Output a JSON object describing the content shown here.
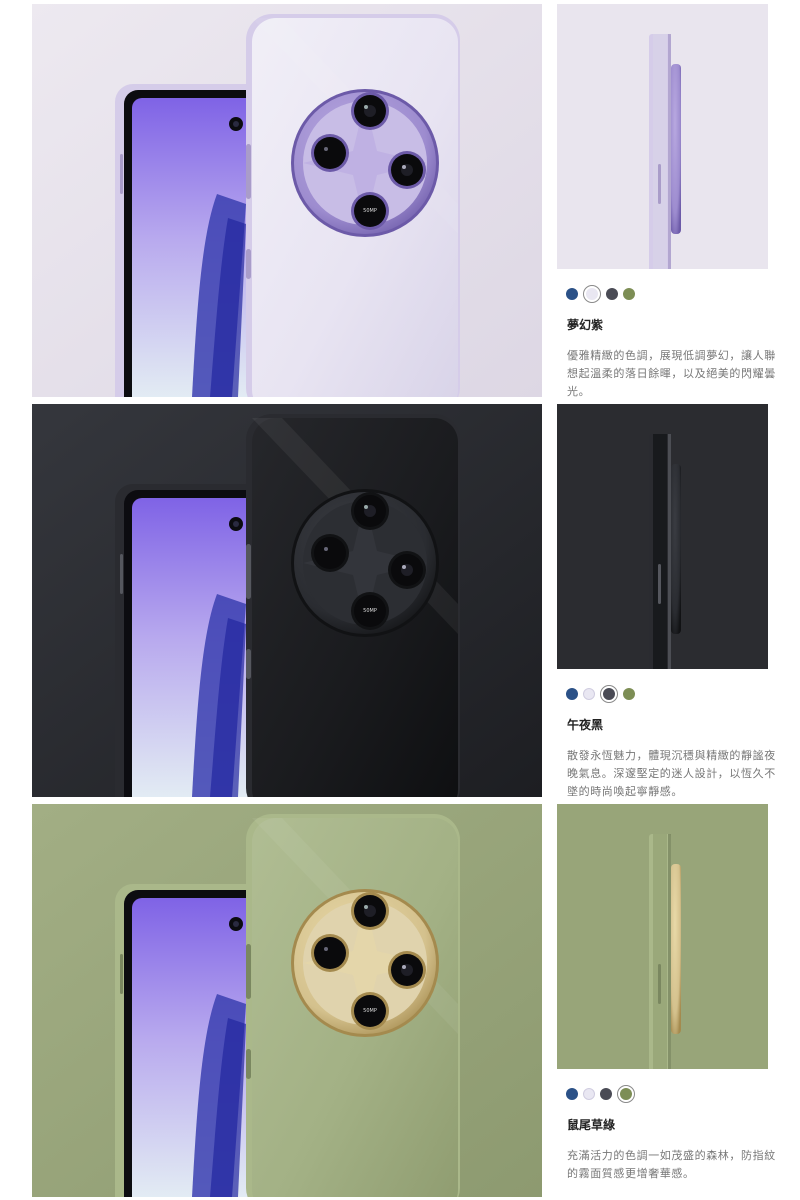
{
  "colors": [
    {
      "name": "夢幻紫",
      "description": "優雅精緻的色調，展現低調夢幻，讓人聯想起溫柔的落日餘暉，以及絕美的閃耀曇光。",
      "selected_index": 1,
      "theme": {
        "bg1": "#ede9f0",
        "bg2": "#ddd7e4",
        "body1": "#f1eff7",
        "body2": "#d8d3e8",
        "body3": "#e8e4f2",
        "frame": "#d5cce9",
        "edge": "#a99cc9",
        "ring1": "#b8a8e0",
        "ring2": "#6c5aa8",
        "ring3": "#9d8ccf",
        "plate": "#c8bde6",
        "sideBg": "#e9e5ee"
      }
    },
    {
      "name": "午夜黑",
      "description": "散發永恆魅力，體現沉穩與精緻的靜謐夜晚氣息。深邃堅定的迷人設計，以恆久不墜的時尚喚起寧靜感。",
      "selected_index": 2,
      "theme": {
        "bg1": "#35373d",
        "bg2": "#1d1e22",
        "body1": "#26272b",
        "body2": "#0e0f11",
        "body3": "#1a1b1e",
        "frame": "#2a2b30",
        "edge": "#55575e",
        "ring1": "#3a3c42",
        "ring2": "#111214",
        "ring3": "#2a2c31",
        "plate": "#2c2e33",
        "sideBg": "#2b2c30"
      }
    },
    {
      "name": "鼠尾草綠",
      "description": "充滿活力的色調一如茂盛的森林，防指紋的霧面質感更增奢華感。",
      "selected_index": 3,
      "theme": {
        "bg1": "#a2ae84",
        "bg2": "#8d9a70",
        "body1": "#b0bd93",
        "body2": "#8f9c70",
        "body3": "#a3b185",
        "frame": "#aab88a",
        "edge": "#7a8760",
        "ring1": "#e8d9a8",
        "ring2": "#a48a4e",
        "ring3": "#d4c18d",
        "plate": "#e0d3ad",
        "sideBg": "#98a579"
      }
    }
  ],
  "swatch_colors": [
    "#2b5187",
    "#e9e7f2",
    "#4a4b55",
    "#7d8e55"
  ],
  "lens_label": "50MP"
}
